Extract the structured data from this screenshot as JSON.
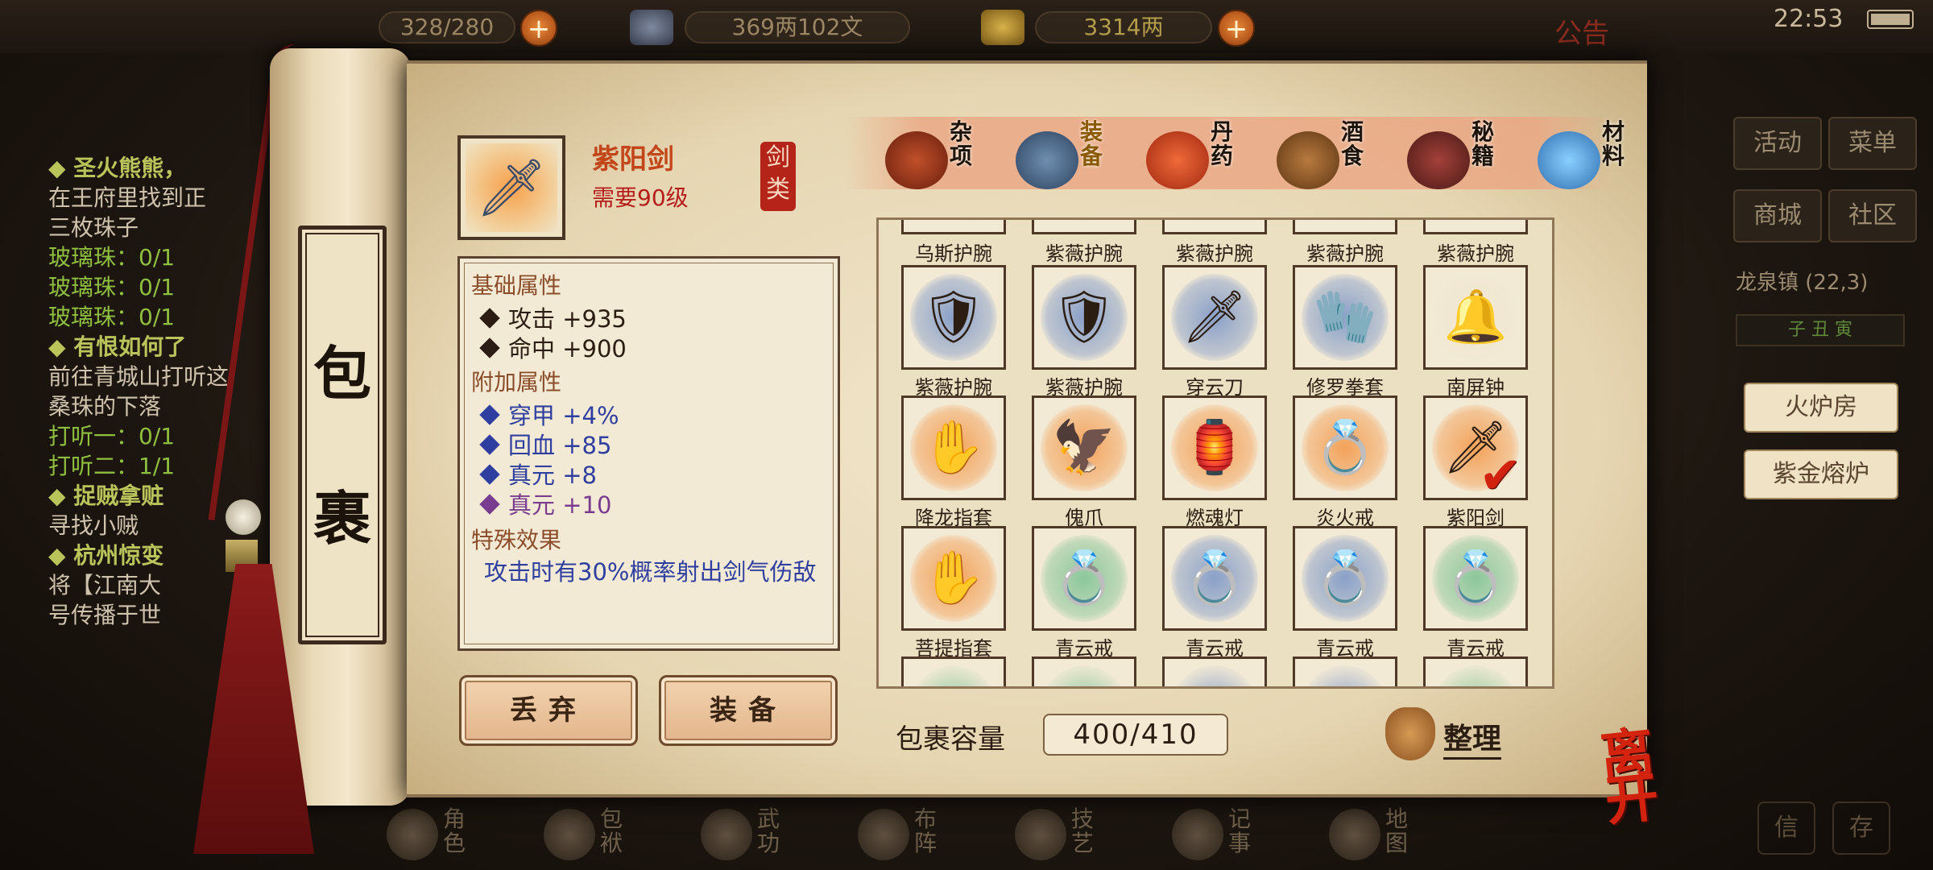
{
  "topbar": {
    "storage_value": "328/280",
    "money": "369两102文",
    "gold": "3314两",
    "notice": "公告",
    "clock": "22:53",
    "plus": "+"
  },
  "quests": [
    {
      "title": "◆ 圣火熊熊，",
      "desc": [
        "在王府里找到正",
        "三枚珠子"
      ],
      "progress": [
        "玻璃珠：0/1",
        "玻璃珠：0/1",
        "玻璃珠：0/1"
      ]
    },
    {
      "title": "◆ 有恨如何了",
      "desc": [
        "前往青城山打听这",
        "桑珠的下落"
      ],
      "progress": [
        "打听一：0/1",
        "打听二：1/1"
      ]
    },
    {
      "title": "◆ 捉贼拿赃",
      "desc": [
        "寻找小贼"
      ],
      "progress": []
    },
    {
      "title": "◆ 杭州惊变",
      "desc": [
        "将【江南大",
        "号传播于世"
      ],
      "progress": []
    }
  ],
  "right_panel": {
    "buttons": [
      "活动",
      "菜单",
      "商城",
      "社区"
    ],
    "location": "龙泉镇 (22,3)",
    "time_strip": "子  丑  寅",
    "facilities": [
      "火炉房",
      "紫金熔炉"
    ],
    "bottom": [
      "信",
      "存"
    ]
  },
  "bottom_nav": [
    "角色",
    "包袱",
    "武功",
    "布阵",
    "技艺",
    "记事",
    "地图"
  ],
  "scroll": {
    "title_top": "包",
    "title_bottom": "裹"
  },
  "selected_item": {
    "name": "紫阳剑",
    "requirement": "需要90级",
    "category_seal": "剑类",
    "base_header": "基础属性",
    "base_stats": [
      "攻击  +935",
      "命中  +900"
    ],
    "extra_header": "附加属性",
    "extra_stats": [
      "穿甲  +4%",
      "回血  +85",
      "真元  +8"
    ],
    "extra_stat_purple": "真元  +10",
    "special_header": "特殊效果",
    "special_text": "攻击时有30%概率射出剑气伤敌"
  },
  "actions": {
    "discard": "丢弃",
    "equip": "装备"
  },
  "tabs": [
    {
      "label": "杂项",
      "icon": "jar-icon"
    },
    {
      "label": "装备",
      "icon": "equipment-icon",
      "active": true
    },
    {
      "label": "丹药",
      "icon": "pill-icon"
    },
    {
      "label": "酒食",
      "icon": "food-icon"
    },
    {
      "label": "秘籍",
      "icon": "book-icon"
    },
    {
      "label": "材料",
      "icon": "crystal-icon"
    }
  ],
  "grid": {
    "partial_top_labels": [
      "乌斯护腕",
      "紫薇护腕",
      "紫薇护腕",
      "紫薇护腕",
      "紫薇护腕"
    ],
    "rows": [
      [
        {
          "label": "紫薇护腕",
          "icon": "bracer-icon",
          "bg": "#8aa0c8"
        },
        {
          "label": "紫薇护腕",
          "icon": "bracer-icon",
          "bg": "#8aa0c8"
        },
        {
          "label": "穿云刀",
          "icon": "blade-icon",
          "bg": "#8aa0c8"
        },
        {
          "label": "修罗拳套",
          "icon": "gauntlet-icon",
          "bg": "#8aa0c8"
        },
        {
          "label": "南屏钟",
          "icon": "bell-icon",
          "bg": "#f0e6d0"
        }
      ],
      [
        {
          "label": "降龙指套",
          "icon": "finger-guard-icon",
          "bg": "#f3a25a"
        },
        {
          "label": "傀爪",
          "icon": "claw-icon",
          "bg": "#f3a25a"
        },
        {
          "label": "燃魂灯",
          "icon": "lantern-icon",
          "bg": "#f3a25a"
        },
        {
          "label": "炎火戒",
          "icon": "ring-icon",
          "bg": "#f3a25a"
        },
        {
          "label": "紫阳剑",
          "icon": "sword-icon",
          "bg": "#f3a25a",
          "equipped": true
        }
      ],
      [
        {
          "label": "菩提指套",
          "icon": "finger-guard-icon",
          "bg": "#f3a25a"
        },
        {
          "label": "青云戒",
          "icon": "jade-ring-icon",
          "bg": "#8cc79a"
        },
        {
          "label": "青云戒",
          "icon": "jade-ring-icon",
          "bg": "#8aa0c8"
        },
        {
          "label": "青云戒",
          "icon": "jade-ring-icon",
          "bg": "#8aa0c8"
        },
        {
          "label": "青云戒",
          "icon": "jade-ring-icon",
          "bg": "#8cc79a"
        }
      ]
    ],
    "partial_bottom_bg": [
      "#8cc79a",
      "#8cc79a",
      "#8aa0c8",
      "#8aa0c8",
      "#8cc79a"
    ]
  },
  "capacity": {
    "label": "包裹容量",
    "value": "400/410"
  },
  "sort_label": "整理",
  "leave_label": "离开",
  "check_mark": "✔"
}
